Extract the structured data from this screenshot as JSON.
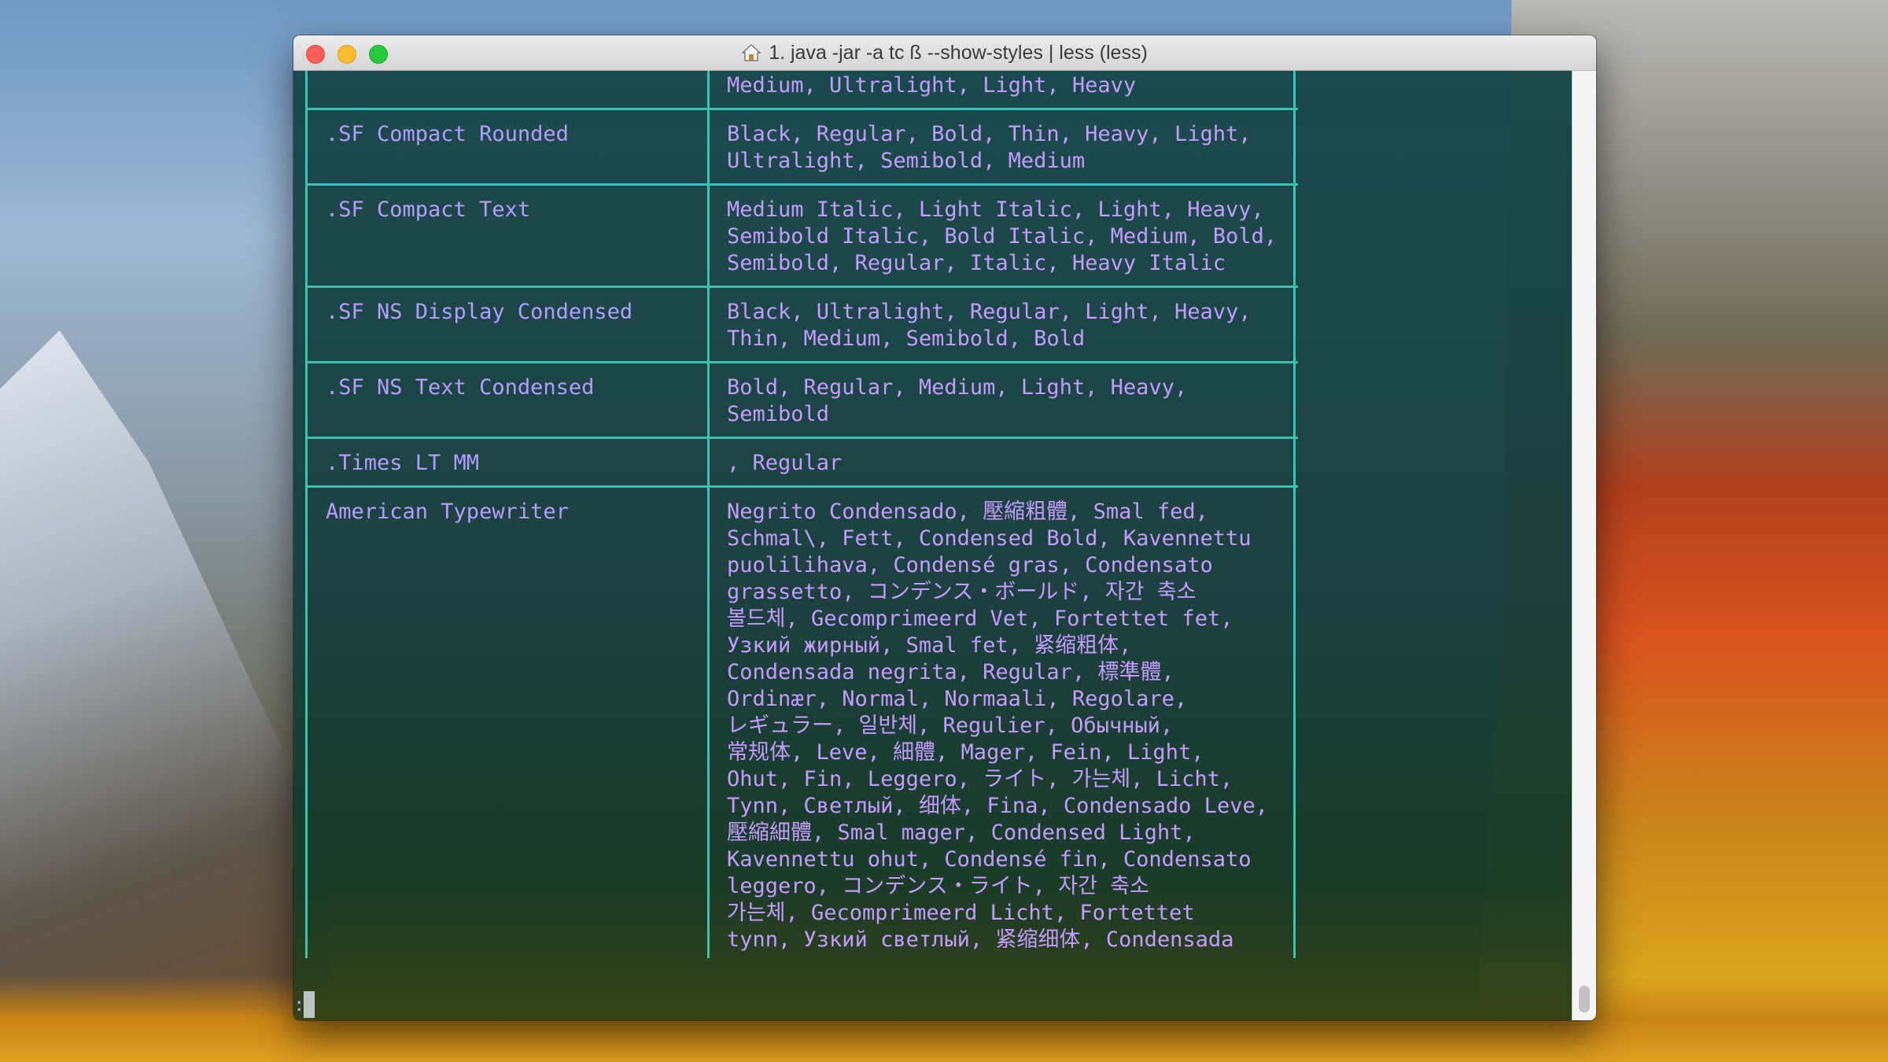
{
  "window": {
    "title": "1. java -jar  -a tc ß --show-styles | less (less)",
    "title_icon": "home-icon"
  },
  "colors": {
    "border": "#3cc2b3",
    "text": "#c49bff",
    "close": "#fc5f57",
    "minimize": "#fdbc2e",
    "zoom": "#28c840"
  },
  "terminal": {
    "prompt": ":",
    "rows": [
      {
        "name": "",
        "styles": "Medium, Ultralight, Light, Heavy"
      },
      {
        "name": ".SF Compact Rounded",
        "styles": "Black, Regular, Bold, Thin, Heavy, Light,\nUltralight, Semibold, Medium"
      },
      {
        "name": ".SF Compact Text",
        "styles": "Medium Italic, Light Italic, Light, Heavy,\nSemibold Italic, Bold Italic, Medium, Bold,\nSemibold, Regular, Italic, Heavy Italic"
      },
      {
        "name": ".SF NS Display Condensed",
        "styles": "Black, Ultralight, Regular, Light, Heavy,\nThin, Medium, Semibold, Bold"
      },
      {
        "name": ".SF NS Text Condensed",
        "styles": "Bold, Regular, Medium, Light, Heavy,\nSemibold"
      },
      {
        "name": ".Times LT MM",
        "styles": ", Regular"
      },
      {
        "name": "American Typewriter",
        "styles": "Negrito Condensado, 壓縮粗體, Smal fed,\nSchmal\\, Fett, Condensed Bold, Kavennettu\npuolilihava, Condensé gras, Condensato\ngrassetto, コンデンス・ボールド, 자간 축소\n볼드체, Gecomprimeerd Vet, Fortettet fet,\nУзкий жирный, Smal fet, 紧缩粗体,\nCondensada negrita, Regular, 標準體,\nOrdinær, Normal, Normaali, Regolare,\nレギュラー, 일반체, Regulier, Обычный,\n常规体, Leve, 細體, Mager, Fein, Light,\nOhut, Fin, Leggero, ライト, 가는체, Licht,\nTynn, Светлый, 细体, Fina, Condensado Leve,\n壓縮細體, Smal mager, Condensed Light,\nKavennettu ohut, Condensé fin, Condensato\nleggero, コンデンス・ライト, 자간 축소\n가는체, Gecomprimeerd Licht, Fortettet\ntynn, Узкий светлый, 紧缩细体, Condensada"
      }
    ]
  }
}
